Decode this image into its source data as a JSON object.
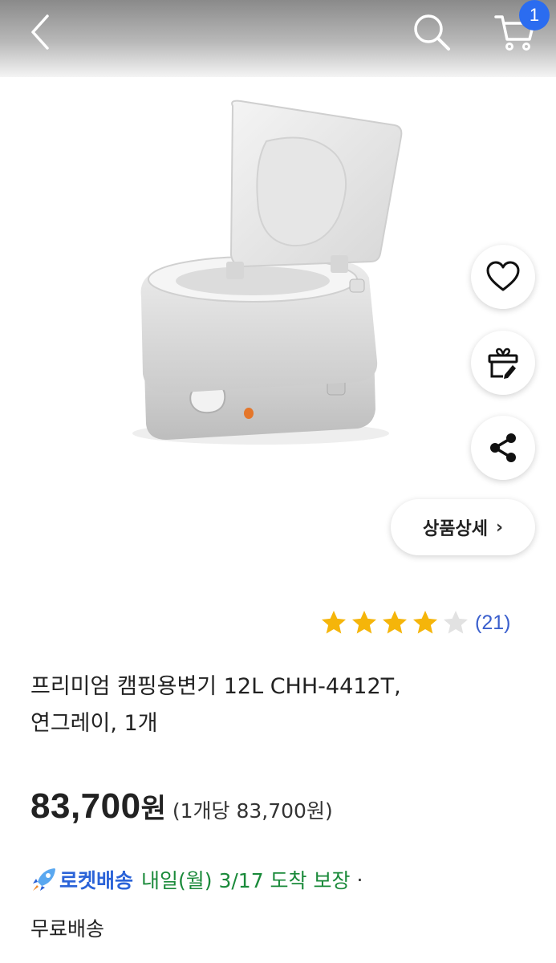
{
  "header": {
    "cart_count": "1",
    "icons": [
      "back-arrow-icon",
      "search-icon",
      "cart-icon"
    ]
  },
  "actions": {
    "icons": [
      "heart-icon",
      "gift-icon",
      "share-icon"
    ],
    "detail_label": "상품상세",
    "detail_chevron": "›"
  },
  "rating": {
    "stars": 4,
    "max_stars": 5,
    "count_text": "(21)",
    "star_color": "#f5b50a",
    "star_empty_color": "#e2e2e2"
  },
  "product": {
    "title_line1": "프리미엄 캠핑용변기 12L CHH-4412T,",
    "title_line2": "연그레이, 1개",
    "price": "83,700",
    "price_unit": "원",
    "unit_price": "(1개당 83,700원)"
  },
  "delivery": {
    "rocket_label": "로켓배송",
    "arrival_text": "내일(월) 3/17 도착 보장",
    "separator": "·",
    "shipping_text": "무료배송",
    "rocket_color": "#2b63d8",
    "arrival_color": "#1a8a3a"
  },
  "colors": {
    "badge": "#2b6cf0",
    "review_link": "#3a5fcd"
  }
}
